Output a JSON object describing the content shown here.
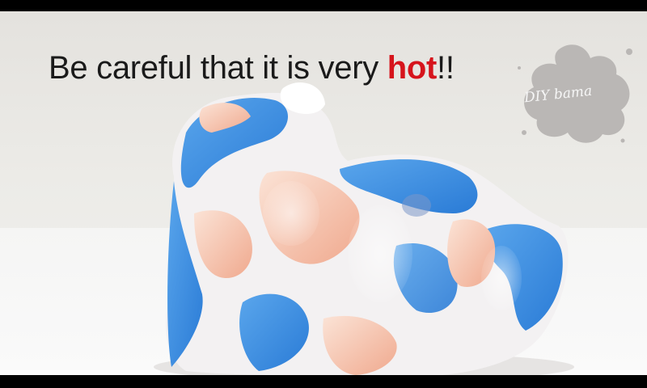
{
  "caption": {
    "before": "Be careful that it is very ",
    "highlight": "hot",
    "after": "!!",
    "highlight_color": "#d6141c"
  },
  "watermark": {
    "text": "DIY bama",
    "splat_color": "#b9b6b4"
  },
  "subject": {
    "description_icon": "marbled-dough-icon",
    "colors": [
      "#2f86e0",
      "#f3b49c",
      "#ffffff"
    ]
  }
}
